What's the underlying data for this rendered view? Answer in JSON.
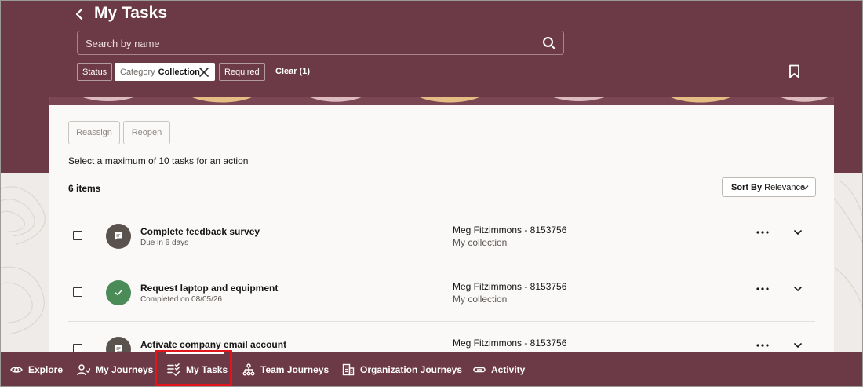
{
  "header": {
    "title": "My Tasks",
    "search_placeholder": "Search by name"
  },
  "filters": {
    "status_label": "Status",
    "category_label": "Category",
    "category_value": "Collection",
    "required_label": "Required",
    "clear_label": "Clear (1)"
  },
  "actions": {
    "reassign_label": "Reassign",
    "reopen_label": "Reopen",
    "hint": "Select a maximum of 10 tasks for an action"
  },
  "list": {
    "item_count": "6 items",
    "sort_label": "Sort By",
    "sort_value": "Relevance",
    "tasks": [
      {
        "title": "Complete feedback survey",
        "subtitle": "Due in 6 days",
        "person": "Meg Fitzimmons - 8153756",
        "collection": "My collection",
        "icon": "comment-icon"
      },
      {
        "title": "Request laptop and equipment",
        "subtitle": "Completed on 08/05/26",
        "person": "Meg Fitzimmons - 8153756",
        "collection": "My collection",
        "icon": "check-icon"
      },
      {
        "title": "Activate company email account",
        "subtitle": "",
        "person": "Meg Fitzimmons - 8153756",
        "collection": "",
        "icon": "comment-icon"
      }
    ]
  },
  "nav": {
    "items": [
      {
        "label": "Explore",
        "icon": "eye-icon"
      },
      {
        "label": "My Journeys",
        "icon": "person-route-icon"
      },
      {
        "label": "My Tasks",
        "icon": "checklist-icon"
      },
      {
        "label": "Team Journeys",
        "icon": "team-hierarchy-icon"
      },
      {
        "label": "Organization Journeys",
        "icon": "building-icon"
      },
      {
        "label": "Activity",
        "icon": "link-icon"
      }
    ]
  },
  "colors": {
    "header_bg": "#6c3a46",
    "active_outline": "#e0161c",
    "complete_green": "#4b8b58"
  }
}
